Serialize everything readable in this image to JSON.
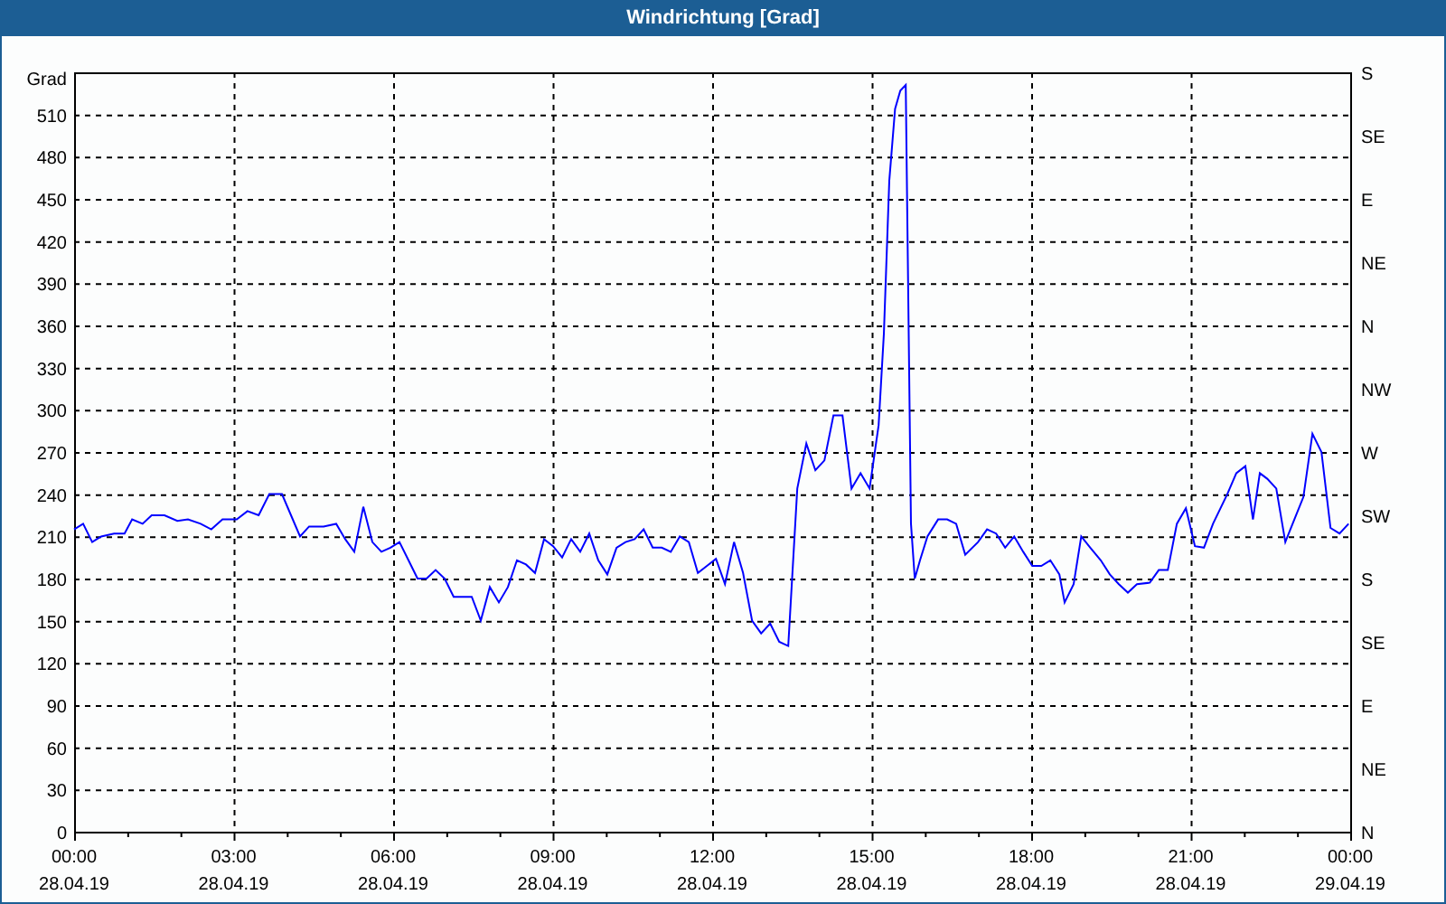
{
  "window": {
    "title": "Windrichtung [Grad]"
  },
  "chart": {
    "chart_data": {
      "type": "line",
      "ylabel": "Grad",
      "xlim": [
        0,
        24
      ],
      "ylim": [
        0,
        540
      ],
      "x": [
        0,
        0.17,
        0.34,
        0.51,
        0.75,
        0.95,
        1.09,
        1.29,
        1.46,
        1.7,
        1.94,
        2.14,
        2.38,
        2.58,
        2.79,
        3.06,
        3.26,
        3.47,
        3.67,
        3.91,
        4.08,
        4.25,
        4.42,
        4.69,
        4.93,
        5.1,
        5.27,
        5.44,
        5.61,
        5.78,
        5.95,
        6.12,
        6.29,
        6.46,
        6.63,
        6.8,
        6.97,
        7.14,
        7.31,
        7.48,
        7.65,
        7.82,
        7.99,
        8.16,
        8.33,
        8.5,
        8.67,
        8.84,
        9.01,
        9.18,
        9.35,
        9.52,
        9.69,
        9.86,
        10.03,
        10.2,
        10.37,
        10.54,
        10.71,
        10.88,
        11.05,
        11.22,
        11.39,
        11.56,
        11.73,
        11.9,
        12.07,
        12.24,
        12.41,
        12.58,
        12.75,
        12.92,
        13.09,
        13.26,
        13.43,
        13.6,
        13.77,
        13.94,
        14.11,
        14.28,
        14.45,
        14.62,
        14.79,
        14.96,
        15.13,
        15.23,
        15.33,
        15.44,
        15.54,
        15.64,
        15.74,
        15.81,
        15.91,
        16.05,
        16.25,
        16.42,
        16.59,
        16.76,
        17.0,
        17.17,
        17.34,
        17.51,
        17.68,
        17.85,
        18.02,
        18.19,
        18.36,
        18.53,
        18.63,
        18.8,
        18.94,
        19.11,
        19.31,
        19.48,
        19.65,
        19.82,
        19.99,
        20.23,
        20.4,
        20.57,
        20.74,
        20.91,
        21.08,
        21.25,
        21.42,
        21.69,
        21.86,
        22.03,
        22.17,
        22.3,
        22.44,
        22.61,
        22.78,
        22.95,
        23.12,
        23.29,
        23.46,
        23.63,
        23.8,
        23.97
      ],
      "grid": true,
      "series": [
        {
          "color": "#0000ff",
          "values": [
            215,
            219,
            206,
            210,
            212,
            212,
            222,
            219,
            225,
            225,
            221,
            222,
            219,
            215,
            222,
            222,
            228,
            225,
            240,
            240,
            225,
            210,
            217,
            217,
            219,
            208,
            199,
            231,
            206,
            199,
            202,
            206,
            193,
            180,
            180,
            186,
            180,
            167,
            167,
            167,
            150,
            174,
            163,
            174,
            193,
            190,
            184,
            208,
            203,
            195,
            208,
            199,
            212,
            193,
            183,
            202,
            206,
            208,
            215,
            202,
            202,
            199,
            210,
            206,
            184,
            189,
            194,
            176,
            206,
            184,
            150,
            141,
            148,
            135,
            132,
            244,
            276,
            257,
            264,
            296,
            296,
            244,
            255,
            244,
            289,
            354,
            463,
            514,
            527,
            531,
            219,
            180,
            193,
            210,
            222,
            222,
            219,
            197,
            206,
            215,
            212,
            202,
            210,
            199,
            189,
            189,
            193,
            183,
            163,
            176,
            210,
            202,
            193,
            183,
            176,
            170,
            176,
            177,
            186,
            186,
            219,
            230,
            203,
            202,
            219,
            240,
            255,
            260,
            222,
            255,
            251,
            244,
            206,
            222,
            238,
            283,
            270,
            216,
            212,
            219
          ]
        }
      ],
      "yticks": [
        0,
        30,
        60,
        90,
        120,
        150,
        180,
        210,
        240,
        270,
        300,
        330,
        360,
        390,
        420,
        450,
        480,
        510
      ],
      "xticks": [
        {
          "value": 0,
          "label": "00:00"
        },
        {
          "value": 3,
          "label": "03:00"
        },
        {
          "value": 6,
          "label": "06:00"
        },
        {
          "value": 9,
          "label": "09:00"
        },
        {
          "value": 12,
          "label": "12:00"
        },
        {
          "value": 15,
          "label": "15:00"
        },
        {
          "value": 18,
          "label": "18:00"
        },
        {
          "value": 21,
          "label": "21:00"
        },
        {
          "value": 24,
          "label": "00:00"
        }
      ]
    },
    "date_labels": [
      "28.04.19",
      "28.04.19",
      "28.04.19",
      "28.04.19",
      "28.04.19",
      "28.04.19",
      "28.04.19",
      "28.04.19",
      "29.04.19"
    ],
    "right_axis": [
      "S",
      "SE",
      "E",
      "NE",
      "N",
      "NW",
      "W",
      "SW",
      "S",
      "SE",
      "E",
      "NE",
      "N"
    ]
  }
}
